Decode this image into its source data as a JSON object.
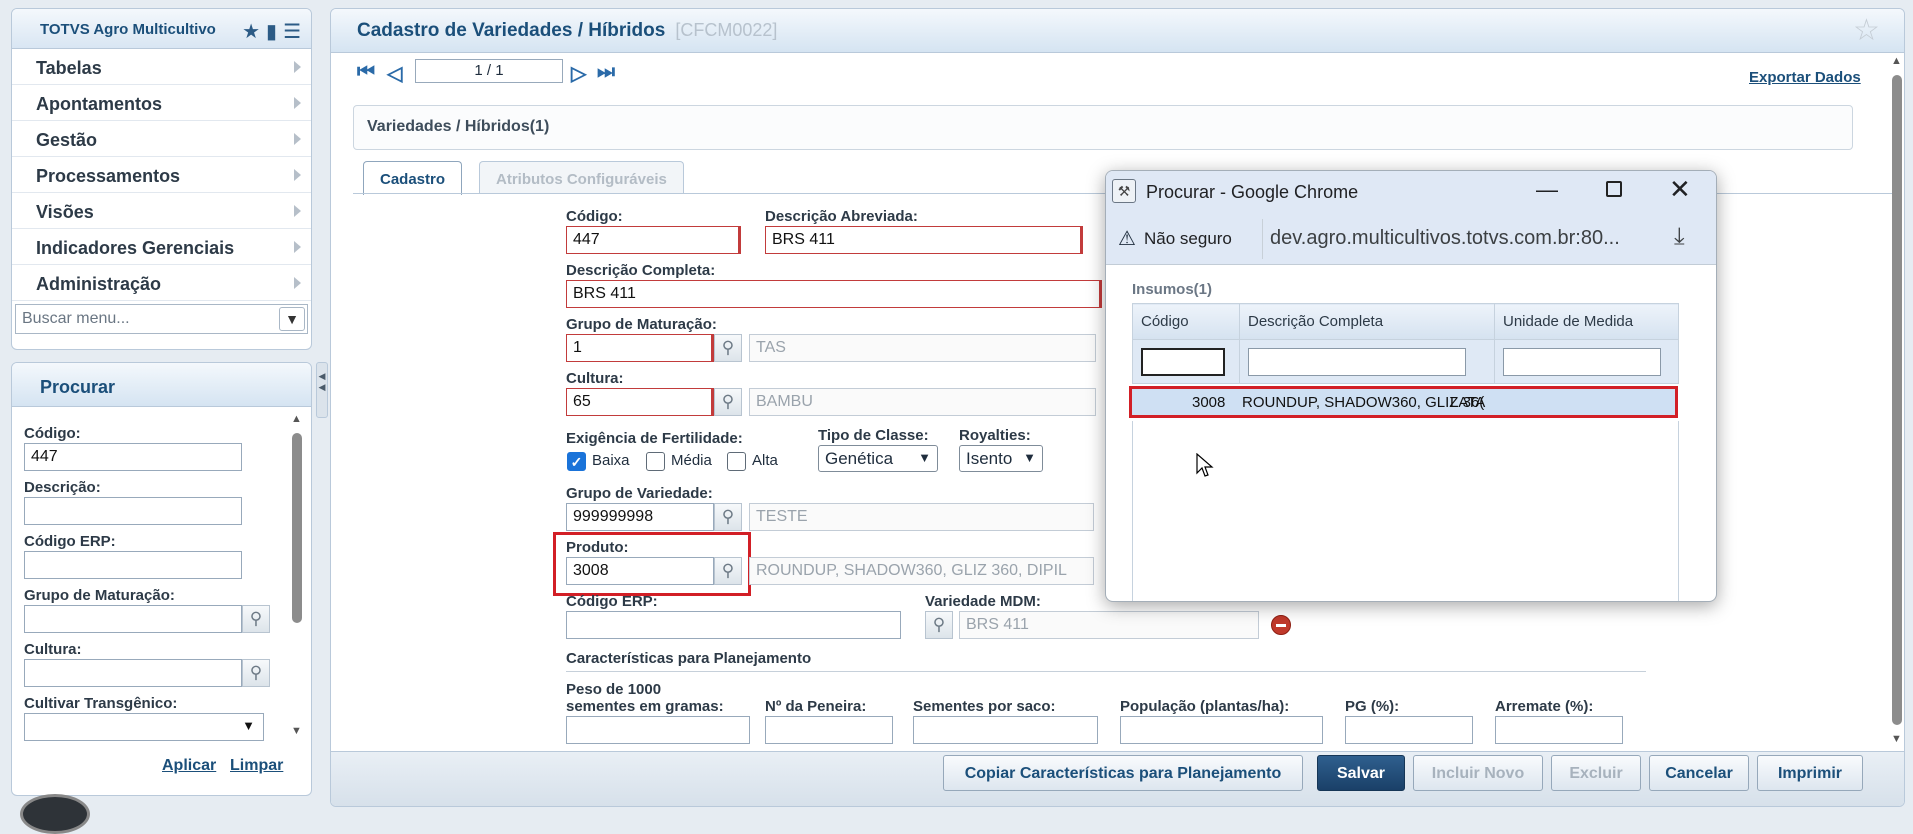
{
  "menu": {
    "title": "TOTVS Agro Multicultivo",
    "items": [
      "Tabelas",
      "Apontamentos",
      "Gestão",
      "Processamentos",
      "Visões",
      "Indicadores Gerenciais",
      "Administração"
    ],
    "search_placeholder": "Buscar menu..."
  },
  "search": {
    "title": "Procurar",
    "codigo_label": "Código:",
    "codigo_value": "447",
    "descricao_label": "Descrição:",
    "codigo_erp_label": "Código ERP:",
    "grupo_label": "Grupo de Maturação:",
    "cultura_label": "Cultura:",
    "cultivar_label": "Cultivar Transgênico:",
    "apply": "Aplicar",
    "clear": "Limpar"
  },
  "main": {
    "title": "Cadastro de Variedades / Híbridos",
    "code": "[CFCM0022]",
    "page": "1 / 1",
    "export": "Exportar Dados",
    "subheader": "Variedades / Híbridos(1)",
    "tabs": [
      "Cadastro",
      "Atributos Configuráveis"
    ]
  },
  "form": {
    "codigo_label": "Código:",
    "codigo": "447",
    "desc_abrev_label": "Descrição Abreviada:",
    "desc_abrev": "BRS 411",
    "desc_comp_label": "Descrição Completa:",
    "desc_comp": "BRS 411",
    "grupo_label": "Grupo de Maturação:",
    "grupo": "1",
    "grupo_desc": "TAS",
    "cultura_label": "Cultura:",
    "cultura": "65",
    "cultura_desc": "BAMBU",
    "fert_label": "Exigência de Fertilidade:",
    "fert_opts": [
      "Baixa",
      "Média",
      "Alta"
    ],
    "tipo_label": "Tipo de Classe:",
    "tipo": "Genética",
    "royal_label": "Royalties:",
    "royal": "Isento",
    "grupo_var_label": "Grupo de Variedade:",
    "grupo_var": "999999998",
    "grupo_var_desc": "TESTE",
    "produto_label": "Produto:",
    "produto": "3008",
    "produto_desc": "ROUNDUP, SHADOW360, GLIZ 360, DIPIL",
    "codigo_erp_label": "Código ERP:",
    "var_mdm_label": "Variedade MDM:",
    "var_mdm": "BRS 411",
    "plan_title": "Características para Planejamento",
    "peso_label_1": "Peso de 1000",
    "peso_label_2": "sementes em gramas:",
    "peneira_label": "Nº da Peneira:",
    "sementes_label": "Sementes por saco:",
    "populacao_label": "População (plantas/ha):",
    "pg_label": "PG (%):",
    "arremate_label": "Arremate (%):"
  },
  "buttons": {
    "copy": "Copiar Características para Planejamento",
    "save": "Salvar",
    "new": "Incluir Novo",
    "delete": "Excluir",
    "cancel": "Cancelar",
    "print": "Imprimir"
  },
  "popup": {
    "title": "Procurar - Google Chrome",
    "not_secure": "Não seguro",
    "url": "dev.agro.multicultivos.totvs.com.br:80...",
    "grid_title": "Insumos(1)",
    "columns": [
      "Código",
      "Descrição Completa",
      "Unidade de Medida"
    ],
    "row": {
      "codigo": "3008",
      "descricao": "ROUNDUP, SHADOW360, GLIZ 36(",
      "unidade": "LATA"
    }
  },
  "colors": {
    "accent": "#1b4f7a",
    "required": "#c23b3b",
    "highlight": "#d21f26",
    "row_selected": "#cfe0f3"
  }
}
